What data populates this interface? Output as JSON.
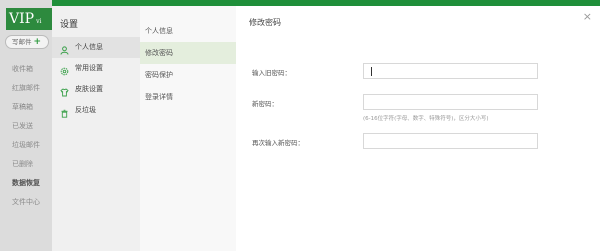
{
  "app": {
    "logo": "VIP",
    "logo_suffix": "vi",
    "compose_label": "写邮件",
    "compose_plus": "+",
    "folders": [
      "收件箱",
      "红旗邮件",
      "草稿箱",
      "已发送",
      "垃圾邮件",
      "已删除",
      "数据恢复",
      "文件中心"
    ]
  },
  "settings": {
    "title": "设置",
    "nav": [
      {
        "label": "个人信息",
        "icon": "user-icon",
        "active": true
      },
      {
        "label": "常用设置",
        "icon": "gear-icon",
        "active": false
      },
      {
        "label": "皮肤设置",
        "icon": "shirt-icon",
        "active": false
      },
      {
        "label": "反垃圾",
        "icon": "trash-icon",
        "active": false
      }
    ],
    "subnav": [
      {
        "label": "个人信息",
        "active": false
      },
      {
        "label": "修改密码",
        "active": true
      },
      {
        "label": "密码保护",
        "active": false
      },
      {
        "label": "登录详情",
        "active": false
      }
    ]
  },
  "panel": {
    "title": "修改密码",
    "close_icon": "close-icon",
    "close_glyph": "×",
    "old_password_label": "输入旧密码：",
    "old_password_value": "",
    "new_password_label": "新密码：",
    "new_password_value": "",
    "new_password_hint": "(6-16位字符(字母、数字、特殊符号)，区分大小写)",
    "confirm_password_label": "再次输入新密码：",
    "confirm_password_value": ""
  },
  "colors": {
    "brand_green": "#2d8a3e",
    "active_subnav": "#e4eedd",
    "icon_green": "#3aa04a"
  }
}
